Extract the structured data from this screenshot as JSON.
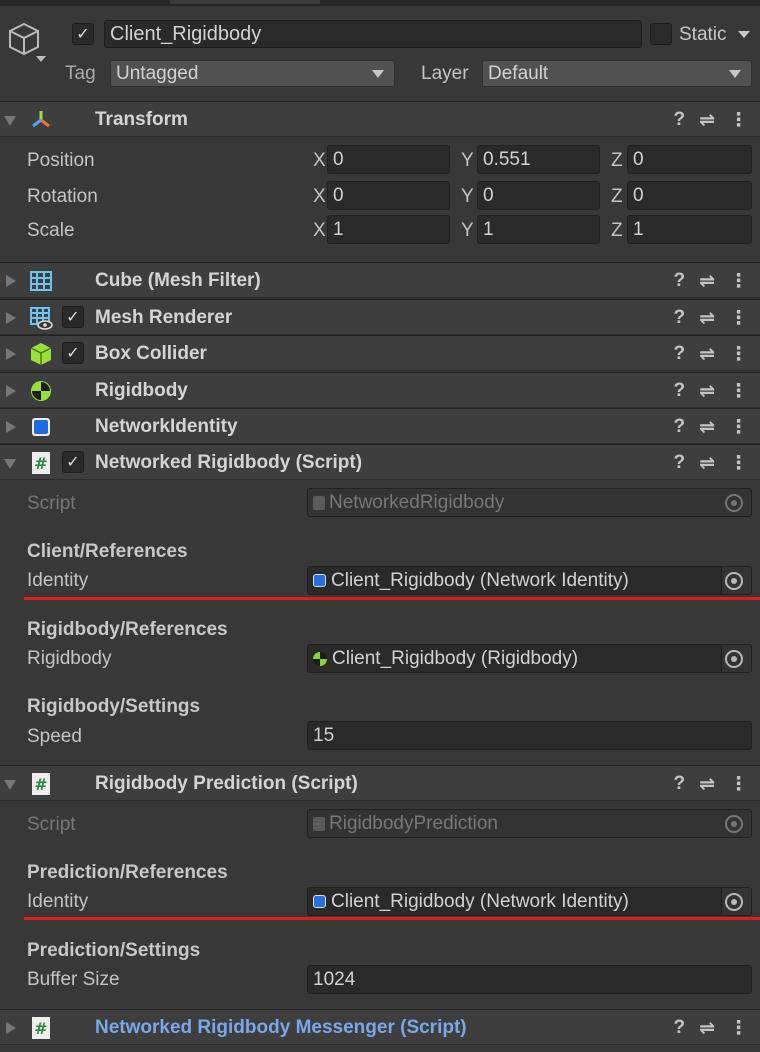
{
  "header": {
    "name": "Client_Rigidbody",
    "active": true,
    "static_label": "Static",
    "static": false,
    "tag_label": "Tag",
    "tag_value": "Untagged",
    "layer_label": "Layer",
    "layer_value": "Default"
  },
  "header_buttons": {
    "help": "?",
    "presets": "⇌",
    "menu": "⋮"
  },
  "transform": {
    "title": "Transform",
    "rows": [
      {
        "label": "Position",
        "x": "0",
        "y": "0.551",
        "z": "0"
      },
      {
        "label": "Rotation",
        "x": "0",
        "y": "0",
        "z": "0"
      },
      {
        "label": "Scale",
        "x": "1",
        "y": "1",
        "z": "1"
      }
    ],
    "axes": {
      "x": "X",
      "y": "Y",
      "z": "Z"
    }
  },
  "components": [
    {
      "title": "Cube (Mesh Filter)",
      "icon": "mesh-filter-icon"
    },
    {
      "title": "Mesh Renderer",
      "icon": "mesh-renderer-icon",
      "enabled": true
    },
    {
      "title": "Box Collider",
      "icon": "box-collider-icon",
      "enabled": true
    },
    {
      "title": "Rigidbody",
      "icon": "rigidbody-icon"
    },
    {
      "title": "NetworkIdentity",
      "icon": "network-identity-icon"
    }
  ],
  "networked_rigidbody": {
    "title": "Networked Rigidbody (Script)",
    "enabled": true,
    "script_label": "Script",
    "script_value": "NetworkedRigidbody",
    "sec1": "Client/References",
    "identity_label": "Identity",
    "identity_value": "Client_Rigidbody (Network Identity)",
    "sec2": "Rigidbody/References",
    "rigidbody_label": "Rigidbody",
    "rigidbody_value": "Client_Rigidbody (Rigidbody)",
    "sec3": "Rigidbody/Settings",
    "speed_label": "Speed",
    "speed_value": "15"
  },
  "prediction": {
    "title": "Rigidbody Prediction (Script)",
    "script_label": "Script",
    "script_value": "RigidbodyPrediction",
    "sec1": "Prediction/References",
    "identity_label": "Identity",
    "identity_value": "Client_Rigidbody (Network Identity)",
    "sec2": "Prediction/Settings",
    "buffer_label": "Buffer Size",
    "buffer_value": "1024"
  },
  "messenger": {
    "title": "Networked Rigidbody Messenger (Script)"
  },
  "colors": {
    "highlight": "#e01b1b",
    "link_title": "#7aa7e8"
  }
}
